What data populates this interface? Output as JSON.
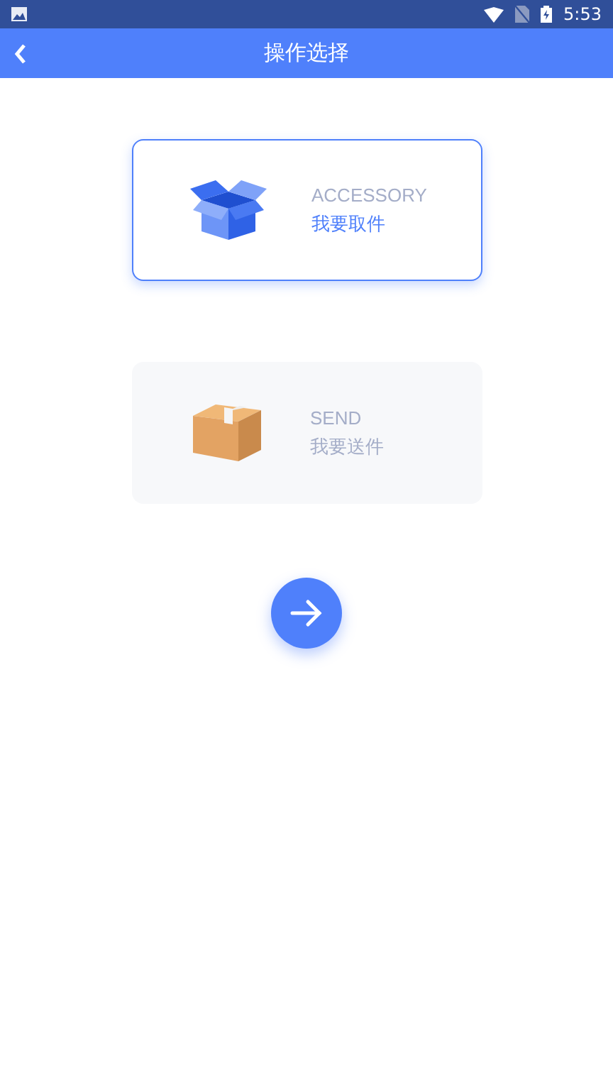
{
  "status_bar": {
    "time": "5:53"
  },
  "header": {
    "title": "操作选择"
  },
  "options": [
    {
      "kind": "open-box",
      "title": "ACCESSORY",
      "label": "我要取件",
      "selected": true
    },
    {
      "kind": "closed-box",
      "title": "SEND",
      "label": "我要送件",
      "selected": false
    }
  ]
}
